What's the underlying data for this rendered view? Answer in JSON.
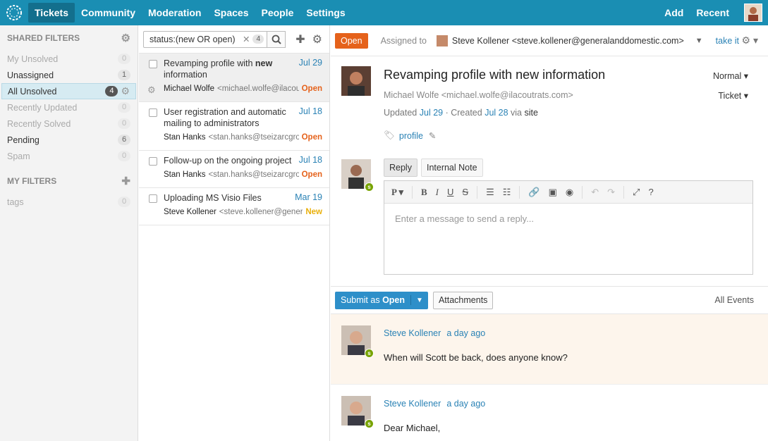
{
  "nav": {
    "items": [
      {
        "label": "Tickets",
        "active": true
      },
      {
        "label": "Community"
      },
      {
        "label": "Moderation"
      },
      {
        "label": "Spaces"
      },
      {
        "label": "People"
      },
      {
        "label": "Settings"
      }
    ],
    "add_label": "Add",
    "recent_label": "Recent"
  },
  "sidebar": {
    "shared_title": "SHARED FILTERS",
    "shared": [
      {
        "label": "My Unsolved",
        "count": "0",
        "muted": true
      },
      {
        "label": "Unassigned",
        "count": "1"
      },
      {
        "label": "All Unsolved",
        "count": "4",
        "active": true
      },
      {
        "label": "Recently Updated",
        "count": "0",
        "muted": true
      },
      {
        "label": "Recently Solved",
        "count": "0",
        "muted": true
      },
      {
        "label": "Pending",
        "count": "6"
      },
      {
        "label": "Spam",
        "count": "0",
        "muted": true
      }
    ],
    "my_title": "MY FILTERS",
    "mine": [
      {
        "label": "tags",
        "count": "0",
        "muted": true
      }
    ]
  },
  "search": {
    "query": "status:(new OR open)",
    "count": "4"
  },
  "tickets": [
    {
      "subject_pre": "Revamping profile with ",
      "subject_bold": "new",
      "subject_post": " information",
      "date": "Jul 29",
      "requester": "Michael Wolfe",
      "email": "<michael.wolfe@ilacoutrats.com>",
      "status": "Open"
    },
    {
      "subject_pre": "User registration and automatic mailing to administrators",
      "subject_bold": "",
      "subject_post": "",
      "date": "Jul 18",
      "requester": "Stan Hanks",
      "email": "<stan.hanks@tseizarcgroup.com>",
      "status": "Open"
    },
    {
      "subject_pre": "Follow-up on the ongoing project",
      "subject_bold": "",
      "subject_post": "",
      "date": "Jul 18",
      "requester": "Stan Hanks",
      "email": "<stan.hanks@tseizarcgroup.com>",
      "status": "Open"
    },
    {
      "subject_pre": "Uploading MS Visio Files",
      "subject_bold": "",
      "subject_post": "",
      "date": "Mar 19",
      "requester": "Steve Kollener",
      "email": "<steve.kollener@generalanddomestic.com>",
      "status": "New"
    }
  ],
  "detail": {
    "status_button": "Open",
    "assigned_label": "Assigned to",
    "assignee": "Steve Kollener <steve.kollener@generalanddomestic.com>",
    "take_it": "take it",
    "title": "Revamping profile with new information",
    "requester": "Michael Wolfe <michael.wolfe@ilacoutrats.com>",
    "updated_label": "Updated",
    "updated_date": "Jul 29",
    "created_label": "· Created",
    "created_date": "Jul 28",
    "via_label": "via",
    "via": "site",
    "tag": "profile",
    "priority": "Normal",
    "type": "Ticket",
    "reply_tab": "Reply",
    "note_tab": "Internal Note",
    "placeholder": "Enter a message to send a reply...",
    "submit_prefix": "Submit as",
    "submit_status": "Open",
    "attachments": "Attachments",
    "all_events": "All Events"
  },
  "events": [
    {
      "author": "Steve Kollener",
      "time": "a day ago",
      "body": "When will Scott be back, does anyone know?"
    },
    {
      "author": "Steve Kollener",
      "time": "a day ago",
      "body": "Dear Michael,"
    }
  ],
  "colors": {
    "topbar": "#1a8eb3",
    "open": "#e5621b",
    "new": "#e9b00c",
    "link": "#2a82b5",
    "submit": "#2d8fc9"
  }
}
